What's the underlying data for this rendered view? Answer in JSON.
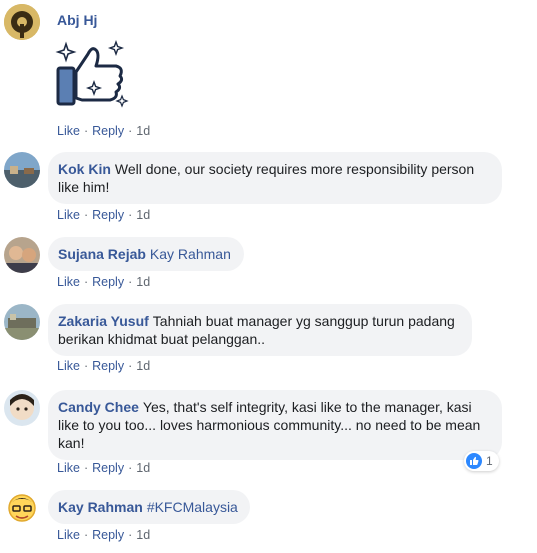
{
  "actions": {
    "like": "Like",
    "reply": "Reply",
    "separator": "·"
  },
  "comments": [
    {
      "name": "Abj Hj",
      "text": "",
      "sticker": "thumbs-up-sparkle-sticker",
      "time": "1d"
    },
    {
      "name": "Kok Kin",
      "text": "Well done, our society requires more responsibility person like him!",
      "time": "1d"
    },
    {
      "name": "Sujana Rejab",
      "tag": "Kay Rahman",
      "text": "",
      "time": "1d"
    },
    {
      "name": "Zakaria Yusuf",
      "text": "Tahniah buat manager yg sanggup turun padang berikan khidmat buat pelanggan..",
      "time": "1d"
    },
    {
      "name": "Candy Chee",
      "text": "Yes, that's self integrity, kasi like to the manager, kasi like to you too... loves harmonious community... no need to be mean kan!",
      "time": "1d",
      "reaction": {
        "icon": "like-icon",
        "count": "1"
      }
    },
    {
      "name": "Kay Rahman",
      "tag": "#KFCMalaysia",
      "text": "",
      "time": "1d"
    }
  ],
  "colors": {
    "name": "#385898",
    "bubble": "#f2f3f5",
    "meta": "#606770",
    "like_blue": "#2d88ff"
  }
}
